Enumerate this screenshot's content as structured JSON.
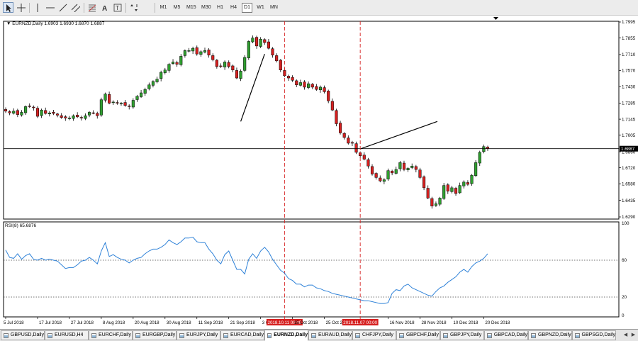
{
  "toolbar": {
    "tools": [
      {
        "name": "cursor-icon",
        "active": true
      },
      {
        "name": "crosshair-icon",
        "active": false
      },
      {
        "name": "vertical-line-icon",
        "active": false
      },
      {
        "name": "horizontal-line-icon",
        "active": false
      },
      {
        "name": "trendline-icon",
        "active": false
      },
      {
        "name": "channel-icon",
        "active": false
      },
      {
        "name": "fibonacci-icon",
        "active": false
      },
      {
        "name": "text-icon",
        "active": false
      },
      {
        "name": "text-label-icon",
        "active": false
      },
      {
        "name": "arrows-icon",
        "active": false
      }
    ],
    "timeframes": [
      "M1",
      "M5",
      "M15",
      "M30",
      "H1",
      "H4",
      "D1",
      "W1",
      "MN"
    ],
    "active_timeframe": "D1"
  },
  "chart": {
    "header": "EURNZD,Daily  1.6903 1.6930 1.6870 1.6887",
    "current_price_label": "1.6887",
    "rsi_header": "RSI(8) 65.6876",
    "price_ticks": [
      "1.7995",
      "1.7855",
      "1.7710",
      "1.7570",
      "1.7430",
      "1.7285",
      "1.7145",
      "1.7005",
      "1.6860",
      "1.6720",
      "1.6580",
      "1.6435",
      "1.6290"
    ],
    "rsi_ticks": [
      "100",
      "60",
      "20",
      "0"
    ],
    "date_labels": [
      "5 Jul 2018",
      "17 Jul 2018",
      "27 Jul 2018",
      "8 Aug 2018",
      "20 Aug 2018",
      "30 Aug 2018",
      "11 Sep 2018",
      "21 Sep 2018",
      "3 Oct 2018",
      "2018.10.11 00:00",
      "15 Oct 2018",
      "25 Oct 2018",
      "2018.11.07 00:00",
      "16 Nov 2018",
      "28 Nov 2018",
      "10 Dec 2018",
      "20 Dec 2018"
    ],
    "colors": {
      "bull": "#2f9e2f",
      "bear": "#d62020",
      "rsi_line": "#2f82d8",
      "vline": "#d62020",
      "bg": "#ffffff"
    }
  },
  "chart_data": {
    "type": "candlestick",
    "symbol": "EURNZD",
    "timeframe": "Daily",
    "ylim": [
      1.629,
      1.7995
    ],
    "x": [
      "2018-07-05",
      "2018-07-06",
      "2018-07-09",
      "2018-07-10",
      "2018-07-11",
      "2018-07-12",
      "2018-07-13",
      "2018-07-16",
      "2018-07-17",
      "2018-07-18",
      "2018-07-19",
      "2018-07-20",
      "2018-07-23",
      "2018-07-24",
      "2018-07-25",
      "2018-07-26",
      "2018-07-27",
      "2018-07-30",
      "2018-07-31",
      "2018-08-01",
      "2018-08-02",
      "2018-08-03",
      "2018-08-06",
      "2018-08-07",
      "2018-08-08",
      "2018-08-09",
      "2018-08-10",
      "2018-08-13",
      "2018-08-14",
      "2018-08-15",
      "2018-08-16",
      "2018-08-17",
      "2018-08-20",
      "2018-08-21",
      "2018-08-22",
      "2018-08-23",
      "2018-08-24",
      "2018-08-27",
      "2018-08-28",
      "2018-08-29",
      "2018-08-30",
      "2018-08-31",
      "2018-09-03",
      "2018-09-04",
      "2018-09-05",
      "2018-09-06",
      "2018-09-07",
      "2018-09-10",
      "2018-09-11",
      "2018-09-12",
      "2018-09-13",
      "2018-09-14",
      "2018-09-17",
      "2018-09-18",
      "2018-09-19",
      "2018-09-20",
      "2018-09-21",
      "2018-09-24",
      "2018-09-25",
      "2018-09-26",
      "2018-09-27",
      "2018-09-28",
      "2018-10-01",
      "2018-10-02",
      "2018-10-03",
      "2018-10-04",
      "2018-10-05",
      "2018-10-08",
      "2018-10-09",
      "2018-10-10",
      "2018-10-11",
      "2018-10-12",
      "2018-10-15",
      "2018-10-16",
      "2018-10-17",
      "2018-10-18",
      "2018-10-19",
      "2018-10-22",
      "2018-10-23",
      "2018-10-24",
      "2018-10-25",
      "2018-10-26",
      "2018-10-29",
      "2018-10-30",
      "2018-10-31",
      "2018-11-01",
      "2018-11-02",
      "2018-11-05",
      "2018-11-06",
      "2018-11-07",
      "2018-11-08",
      "2018-11-09",
      "2018-11-12",
      "2018-11-13",
      "2018-11-14",
      "2018-11-15",
      "2018-11-16",
      "2018-11-19",
      "2018-11-20",
      "2018-11-21",
      "2018-11-22",
      "2018-11-23",
      "2018-11-26",
      "2018-11-27",
      "2018-11-28",
      "2018-11-29",
      "2018-11-30",
      "2018-12-03",
      "2018-12-04",
      "2018-12-05",
      "2018-12-06",
      "2018-12-07",
      "2018-12-10",
      "2018-12-11",
      "2018-12-12",
      "2018-12-13",
      "2018-12-14",
      "2018-12-17",
      "2018-12-18",
      "2018-12-19",
      "2018-12-20",
      "2018-12-21"
    ],
    "close": [
      1.7215,
      1.72,
      1.7215,
      1.7185,
      1.7205,
      1.7255,
      1.7255,
      1.7245,
      1.717,
      1.7225,
      1.7195,
      1.72,
      1.7195,
      1.718,
      1.716,
      1.7155,
      1.7155,
      1.7175,
      1.7165,
      1.7155,
      1.7175,
      1.7205,
      1.72,
      1.7175,
      1.7315,
      1.7365,
      1.7285,
      1.7295,
      1.7285,
      1.7285,
      1.7265,
      1.7255,
      1.731,
      1.7345,
      1.7375,
      1.7405,
      1.7445,
      1.7475,
      1.7495,
      1.7555,
      1.7575,
      1.7625,
      1.7645,
      1.7625,
      1.7695,
      1.7745,
      1.7745,
      1.7765,
      1.7715,
      1.7735,
      1.7745,
      1.7705,
      1.7665,
      1.7605,
      1.7605,
      1.7645,
      1.7605,
      1.7575,
      1.7505,
      1.7565,
      1.7685,
      1.7825,
      1.7855,
      1.7785,
      1.7845,
      1.7815,
      1.7765,
      1.7705,
      1.7655,
      1.7575,
      1.7525,
      1.7505,
      1.7485,
      1.7445,
      1.7465,
      1.7425,
      1.7455,
      1.7425,
      1.7405,
      1.7425,
      1.7385,
      1.7305,
      1.7225,
      1.7105,
      1.7025,
      1.6985,
      1.6935,
      1.6935,
      1.6855,
      1.6825,
      1.6795,
      1.6735,
      1.6665,
      1.6635,
      1.6605,
      1.6615,
      1.6695,
      1.6675,
      1.6705,
      1.6765,
      1.6705,
      1.6715,
      1.6735,
      1.6705,
      1.6635,
      1.6545,
      1.6455,
      1.6385,
      1.6405,
      1.6455,
      1.6565,
      1.6515,
      1.6545,
      1.6495,
      1.6565,
      1.6595,
      1.6575,
      1.6655,
      1.6765,
      1.6855,
      1.6905,
      1.6887
    ],
    "rsi_period": 8,
    "rsi_ylim": [
      0,
      100
    ],
    "rsi_levels": [
      60,
      20
    ],
    "rsi_values": [
      71,
      63,
      62,
      67,
      61,
      65,
      67,
      61,
      60,
      62,
      60,
      61,
      60,
      59,
      55,
      51,
      52,
      52,
      55,
      59,
      60,
      63,
      60,
      56,
      70,
      79,
      64,
      66,
      63,
      61,
      60,
      57,
      60,
      62,
      63,
      67,
      70,
      72,
      72,
      74,
      77,
      82,
      79,
      77,
      80,
      84,
      84,
      85,
      80,
      79,
      79,
      72,
      67,
      60,
      56,
      66,
      70,
      60,
      50,
      50,
      45,
      61,
      67,
      62,
      70,
      74,
      69,
      61,
      55,
      49,
      46,
      40,
      38,
      34,
      34,
      31,
      33,
      33,
      30,
      29,
      27,
      26,
      24,
      23,
      22,
      21,
      20,
      19,
      18,
      17,
      16,
      16,
      15,
      14,
      13,
      13,
      14,
      24,
      28,
      27,
      32,
      34,
      30,
      28,
      26,
      24,
      22,
      21,
      26,
      30,
      32,
      36,
      39,
      42,
      47,
      50,
      47,
      53,
      57,
      59,
      62,
      67
    ]
  },
  "tabs": [
    {
      "label": "GBPUSD,Daily",
      "active": false
    },
    {
      "label": "EURUSD,H4",
      "active": false
    },
    {
      "label": "EURCHF,Daily",
      "active": false
    },
    {
      "label": "EURGBP,Daily",
      "active": false
    },
    {
      "label": "EURJPY,Daily",
      "active": false
    },
    {
      "label": "EURCAD,Daily",
      "active": false
    },
    {
      "label": "EURNZD,Daily",
      "active": true
    },
    {
      "label": "EURAUD,Daily",
      "active": false
    },
    {
      "label": "CHFJPY,Daily",
      "active": false
    },
    {
      "label": "GBPCHF,Daily",
      "active": false
    },
    {
      "label": "GBPJPY,Daily",
      "active": false
    },
    {
      "label": "GBPCAD,Daily",
      "active": false
    },
    {
      "label": "GBPNZD,Daily",
      "active": false
    },
    {
      "label": "GBPSGD,Daily",
      "active": false
    }
  ],
  "tab_scroll": [
    "left-arrow-icon",
    "right-arrow-icon"
  ]
}
